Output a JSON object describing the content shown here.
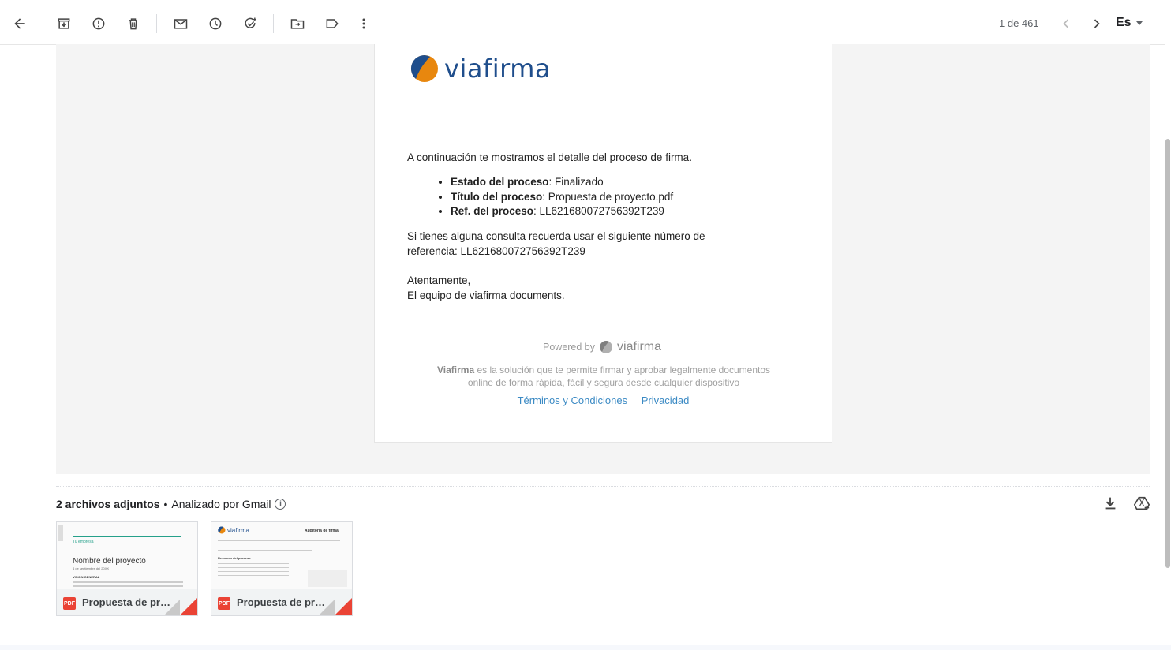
{
  "toolbar": {
    "back_icon": "arrow-left-icon",
    "archive_icon": "archive-icon",
    "spam_icon": "report-spam-icon",
    "delete_icon": "trash-icon",
    "unread_icon": "mail-icon",
    "snooze_icon": "clock-icon",
    "task_icon": "add-task-icon",
    "move_icon": "move-to-folder-icon",
    "label_icon": "label-icon",
    "more_icon": "more-vert-icon",
    "counter": "1 de 461",
    "language": "Es"
  },
  "email": {
    "logo_text": "viafirma",
    "intro": "A continuación te mostramos el detalle del proceso de firma.",
    "details": [
      {
        "label": "Estado del proceso",
        "value": ": Finalizado"
      },
      {
        "label": "Título del proceso",
        "value": ": Propuesta de proyecto.pdf"
      },
      {
        "label": "Ref. del proceso",
        "value": ": LL621680072756392T239"
      }
    ],
    "query_line1": "Si tienes alguna consulta recuerda usar el siguiente número de",
    "query_line2": "referencia: LL621680072756392T239",
    "closing1": "Atentamente,",
    "closing2": "El equipo de viafirma documents.",
    "powered_by": "Powered by",
    "powered_logo": "viafirma",
    "footer_brand": "Viafirma",
    "footer_line1": " es la solución que te permite firmar y aprobar legalmente documentos",
    "footer_line2": "online de forma rápida, fácil y segura desde cualquier dispositivo",
    "link_terms": "Términos y Condiciones",
    "link_privacy": "Privacidad"
  },
  "attachments": {
    "count_label": "2 archivos adjuntos",
    "dot": "•",
    "scanned": "Analizado por Gmail",
    "items": [
      {
        "name": "Propuesta de proyecto.pdf",
        "type": "PDF",
        "thumb_title": "Nombre del proyecto",
        "thumb_company": "Tu empresa",
        "thumb_date": "4 de septiembre del 20XX",
        "thumb_section": "VISIÓN GENERAL"
      },
      {
        "name": "Propuesta de proyecto.pdf",
        "type": "PDF",
        "thumb_logo": "viafirma",
        "thumb_heading": "Auditoría de firma",
        "thumb_section": "Resumen del proceso"
      }
    ]
  },
  "colors": {
    "accent_orange": "#e8870e",
    "brand_blue": "#1f4e8c",
    "link_blue": "#3b8ac4",
    "pdf_red": "#ea4335"
  }
}
